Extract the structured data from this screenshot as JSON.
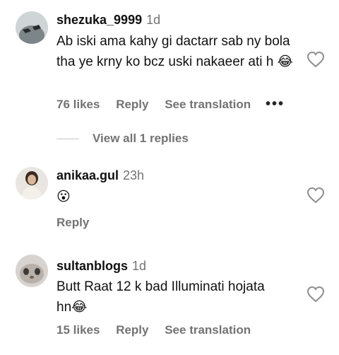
{
  "comments": [
    {
      "username": "shezuka_9999",
      "time": "1d",
      "text": "Ab iski ama kahy gi dactarr sab ny bola tha ye krny ko bcz uski nakaeer ati h",
      "emoji": "😂",
      "likes": "76 likes",
      "reply": "Reply",
      "translate": "See translation",
      "more": "•••",
      "view_replies": "View all 1 replies"
    },
    {
      "username": "anikaa.gul",
      "time": "23h",
      "emoji": "😮",
      "reply": "Reply"
    },
    {
      "username": "sultanblogs",
      "time": "1d",
      "text": "Butt Raat 12 k bad Illuminati hojata hn",
      "emoji": "😂",
      "likes": "15 likes",
      "reply": "Reply",
      "translate": "See translation"
    }
  ]
}
